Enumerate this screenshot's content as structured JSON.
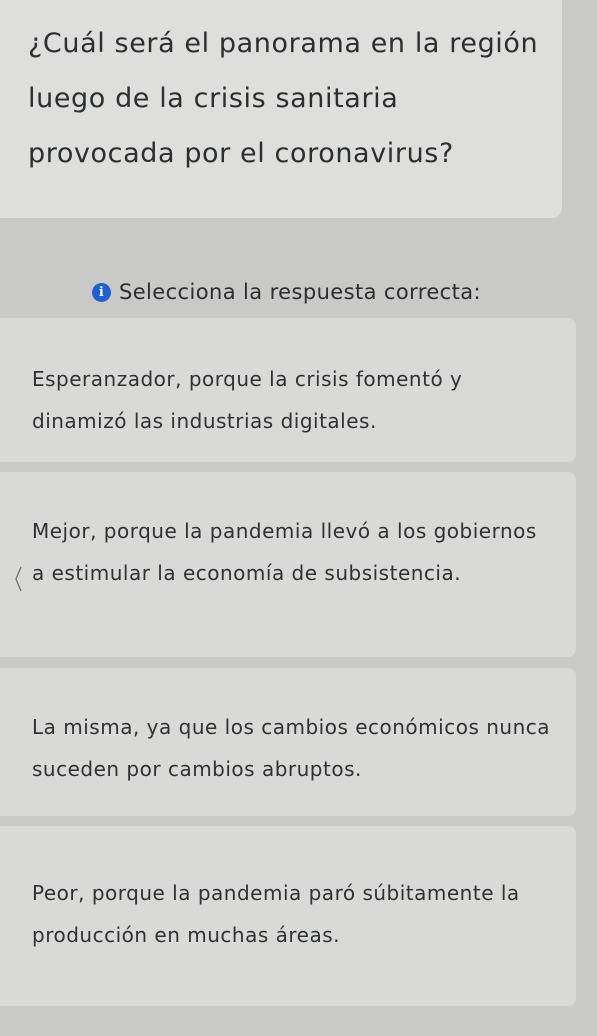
{
  "question": {
    "text": "¿Cuál será el panorama en la región luego de la crisis sanitaria provocada por el coronavirus?"
  },
  "instruction": {
    "icon": "info-icon",
    "text": "Selecciona la respuesta correcta:"
  },
  "options": [
    {
      "text": "Esperanzador, porque la crisis fomentó y dinamizó las industrias digitales."
    },
    {
      "text": "Mejor, porque la pandemia llevó a los gobiernos a estimular la economía de subsistencia."
    },
    {
      "text": "La misma, ya que los cambios económicos nunca suceden por cambios abruptos."
    },
    {
      "text": "Peor, porque la pandemia paró súbitamente la producción en muchas áreas."
    }
  ],
  "colors": {
    "background": "#c9cac8",
    "card": "#d9dad8",
    "info_icon": "#1f5fd1"
  }
}
